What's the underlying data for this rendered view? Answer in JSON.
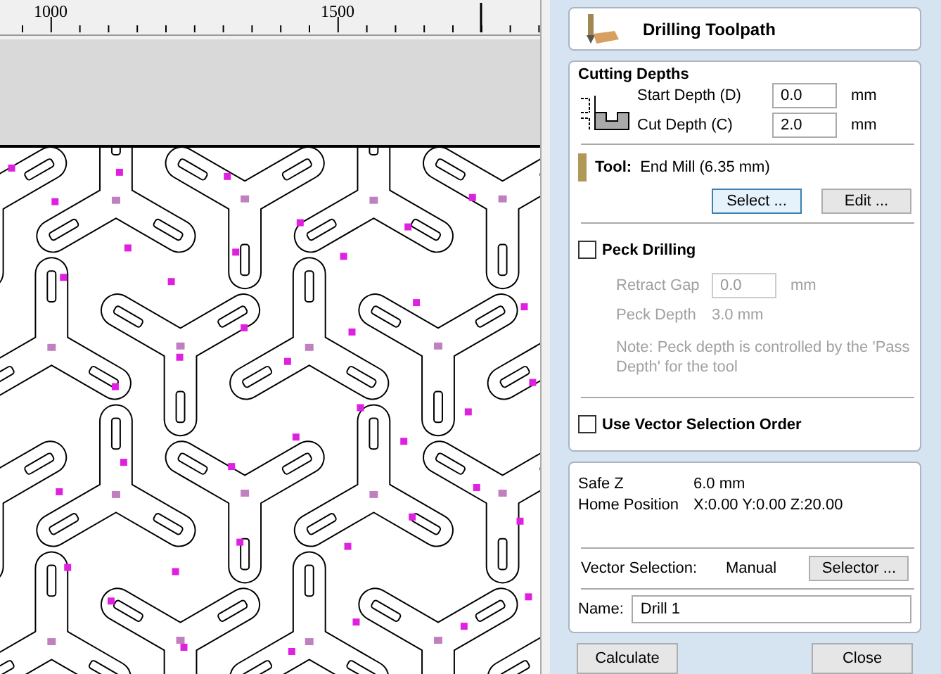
{
  "ruler": {
    "labels": [
      "1000",
      "1500"
    ]
  },
  "panel": {
    "title": "Drilling Toolpath",
    "cutting_depths": {
      "heading": "Cutting Depths",
      "fields": [
        {
          "label": "Start Depth (D)",
          "value": "0.0",
          "unit": "mm"
        },
        {
          "label": "Cut Depth (C)",
          "value": "2.0",
          "unit": "mm"
        }
      ]
    },
    "tool": {
      "label": "Tool:",
      "name": "End Mill (6.35 mm)",
      "buttons": [
        {
          "label": "Select ...",
          "focused": true
        },
        {
          "label": "Edit ...",
          "focused": false
        }
      ]
    },
    "peck_drilling": {
      "label": "Peck Drilling",
      "checked": false,
      "disabled": true,
      "retract_gap": {
        "label": "Retract Gap",
        "value": "0.0",
        "unit": "mm"
      },
      "peck_depth": {
        "label": "Peck Depth",
        "value": "3.0 mm"
      },
      "note": "Note: Peck depth is controlled by the 'Pass Depth' for the tool"
    },
    "vector_order": {
      "label": "Use Vector Selection Order",
      "checked": false
    },
    "info": [
      {
        "label": "Safe Z",
        "value": "6.0 mm"
      },
      {
        "label": "Home Position",
        "value": "X:0.00 Y:0.00 Z:20.00"
      }
    ],
    "vector_selection": {
      "label": "Vector Selection:",
      "value": "Manual",
      "button": "Selector ..."
    },
    "name": {
      "label": "Name:",
      "value": "Drill 1"
    },
    "buttons": [
      "Calculate",
      "Close"
    ]
  }
}
